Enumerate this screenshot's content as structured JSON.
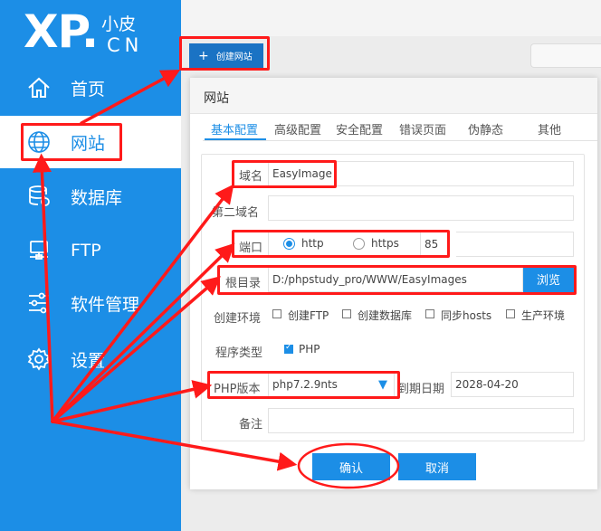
{
  "logo": {
    "brand": "XP.",
    "cn_top": "小皮",
    "cn_bottom": "CN"
  },
  "sidebar": {
    "items": [
      {
        "label": "首页",
        "icon": "home-icon",
        "active": false
      },
      {
        "label": "网站",
        "icon": "globe-icon",
        "active": true
      },
      {
        "label": "数据库",
        "icon": "database-icon",
        "active": false
      },
      {
        "label": "FTP",
        "icon": "monitor-icon",
        "active": false
      },
      {
        "label": "软件管理",
        "icon": "sliders-icon",
        "active": false
      },
      {
        "label": "设置",
        "icon": "gear-icon",
        "active": false
      }
    ]
  },
  "toolbar": {
    "create_label": "创建网站",
    "create_icon": "plus-icon"
  },
  "dialog": {
    "title": "网站",
    "tabs": [
      "基本配置",
      "高级配置",
      "安全配置",
      "错误页面",
      "伪静态",
      "其他"
    ],
    "active_tab": "基本配置",
    "form": {
      "domain_label": "域名",
      "domain_value": "EasyImage",
      "second_domain_label": "第二域名",
      "second_domain_value": "",
      "port_label": "端口",
      "http_label": "http",
      "https_label": "https",
      "port_value": "85",
      "protocol_selected": "http",
      "root_label": "根目录",
      "root_value": "D:/phpstudy_pro/WWW/EasyImages",
      "browse_label": "浏览",
      "env_label": "创建环境",
      "env_options": [
        {
          "label": "创建FTP",
          "checked": false
        },
        {
          "label": "创建数据库",
          "checked": false
        },
        {
          "label": "同步hosts",
          "checked": false
        },
        {
          "label": "生产环境",
          "checked": false
        }
      ],
      "program_label": "程序类型",
      "program_option": {
        "label": "PHP",
        "checked": true
      },
      "php_label": "PHP版本",
      "php_value": "php7.2.9nts",
      "expire_label": "到期日期",
      "expire_value": "2028-04-20",
      "note_label": "备注",
      "note_value": ""
    },
    "confirm_label": "确认",
    "cancel_label": "取消"
  },
  "colors": {
    "sidebar": "#1c8ee6",
    "accent": "#1c8ee6",
    "annotation": "#ff1a1a"
  }
}
